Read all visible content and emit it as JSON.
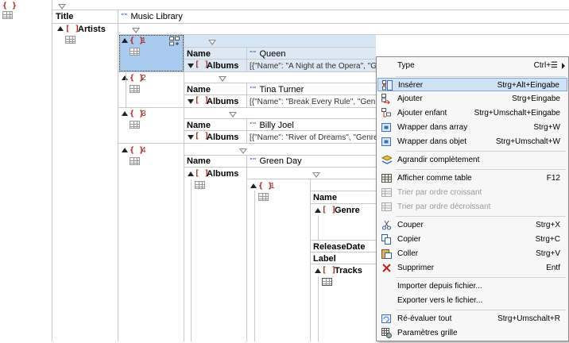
{
  "grid": {
    "title_key": "Title",
    "title_value": "Music Library",
    "artists_key": "Artists",
    "name_key": "Name",
    "albums_key": "Albums",
    "genre_key": "Genre",
    "release_key": "ReleaseDate",
    "label_key": "Label",
    "tracks_key": "Tracks",
    "artists": [
      {
        "index": "1",
        "name": "Queen",
        "albums": "[{\"Name\": \"A Night at the Opera\", \"Genre\"..."
      },
      {
        "index": "2",
        "name": "Tina Turner",
        "albums": "[{\"Name\": \"Break Every Rule\", \"Genre\": [\"R..."
      },
      {
        "index": "3",
        "name": "Billy Joel",
        "albums": "[{\"Name\": \"River of Dreams\", \"Genre\": \"Ro..."
      },
      {
        "index": "4",
        "name": "Green Day"
      }
    ],
    "inner_index": "1"
  },
  "menu": {
    "items": [
      {
        "label": "Type",
        "shortcut": "Ctrl+☰",
        "icon": "none",
        "submenu": true
      },
      {
        "label": "Insérer",
        "shortcut": "Strg+Alt+Eingabe",
        "icon": "insert-icon"
      },
      {
        "label": "Ajouter",
        "shortcut": "Strg+Eingabe",
        "icon": "append-icon"
      },
      {
        "label": "Ajouter enfant",
        "shortcut": "Strg+Umschalt+Eingabe",
        "icon": "add-child-icon"
      },
      {
        "label": "Wrapper dans array",
        "shortcut": "Strg+W",
        "icon": "wrap-array-icon"
      },
      {
        "label": "Wrapper dans objet",
        "shortcut": "Strg+Umschalt+W",
        "icon": "wrap-object-icon"
      },
      {
        "label": "Agrandir complètement",
        "shortcut": "",
        "icon": "expand-icon"
      },
      {
        "label": "Afficher comme table",
        "shortcut": "F12",
        "icon": "table-icon"
      },
      {
        "label": "Trier par ordre croissant",
        "shortcut": "",
        "icon": "sort-asc-icon"
      },
      {
        "label": "Trier par ordre décroissant",
        "shortcut": "",
        "icon": "sort-desc-icon"
      },
      {
        "label": "Couper",
        "shortcut": "Strg+X",
        "icon": "cut-icon"
      },
      {
        "label": "Copier",
        "shortcut": "Strg+C",
        "icon": "copy-icon"
      },
      {
        "label": "Coller",
        "shortcut": "Strg+V",
        "icon": "paste-icon"
      },
      {
        "label": "Supprimer",
        "shortcut": "Entf",
        "icon": "delete-icon"
      },
      {
        "label": "Importer depuis fichier...",
        "shortcut": "",
        "icon": "none"
      },
      {
        "label": "Exporter vers le fichier...",
        "shortcut": "",
        "icon": "none"
      },
      {
        "label": "Ré-évaluer tout",
        "shortcut": "Strg+Umschalt+R",
        "icon": "reevaluate-icon"
      },
      {
        "label": "Paramètres grille",
        "shortcut": "",
        "icon": "grid-settings-icon"
      }
    ]
  }
}
